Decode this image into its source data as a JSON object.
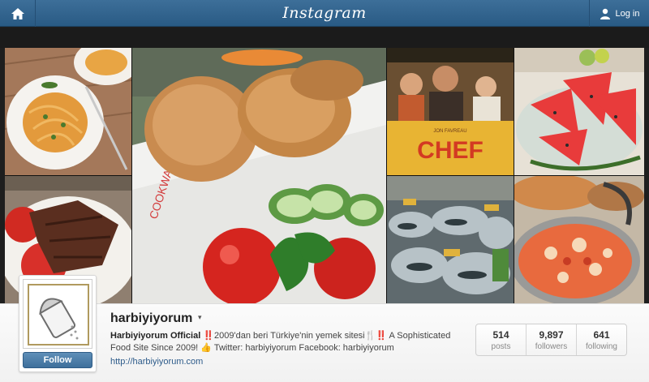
{
  "header": {
    "brand": "Instagram",
    "login_label": "Log in"
  },
  "grid": {
    "tiles": [
      {
        "label": "pasta"
      },
      {
        "label": "fried dough"
      },
      {
        "label": "chef poster",
        "poster_title": "CHEF",
        "poster_credit": "JON FAVREAU"
      },
      {
        "label": "watermelon"
      },
      {
        "label": "grilled meat"
      },
      {
        "label": "fish market"
      },
      {
        "label": "stew"
      }
    ]
  },
  "profile": {
    "username": "harbiyiyorum",
    "caret": "▾",
    "follow_label": "Follow",
    "bio_name": "Harbiyiyorum Official",
    "bio_emoji_1": "‼️",
    "bio_text_1": "2009'dan beri Türkiye'nin yemek sitesi",
    "bio_emoji_2": "🍴",
    "bio_emoji_3": "‼️",
    "bio_text_2": " A Sophisticated Food Site Since 2009! ",
    "bio_emoji_4": "👍",
    "bio_text_3": " Twitter: harbiyiyorum Facebook: harbiyiyorum",
    "website": "http://harbiyiyorum.com"
  },
  "stats": [
    {
      "value": "514",
      "label": "posts"
    },
    {
      "value": "9,897",
      "label": "followers"
    },
    {
      "value": "641",
      "label": "following"
    }
  ]
}
